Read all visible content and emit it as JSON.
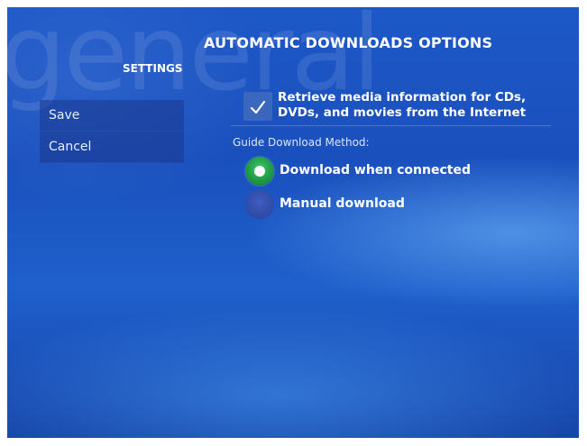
{
  "background_word": "general",
  "page_title": "AUTOMATIC DOWNLOADS OPTIONS",
  "section_label": "SETTINGS",
  "menu": {
    "items": [
      {
        "label": "Save"
      },
      {
        "label": "Cancel"
      }
    ]
  },
  "options": {
    "retrieve_media_info": {
      "label_line1": "Retrieve media information for CDs,",
      "label_line2": "DVDs, and movies from the Internet",
      "checked": true
    },
    "guide_download": {
      "label": "Guide Download Method:",
      "choices": [
        {
          "label": "Download when connected",
          "selected": true
        },
        {
          "label": "Manual download",
          "selected": false
        }
      ]
    }
  },
  "colors": {
    "background": "#1d58c7",
    "radio_selected": "#1f9a46",
    "radio_unselected": "#2f4aa6",
    "text": "#ffffff"
  }
}
